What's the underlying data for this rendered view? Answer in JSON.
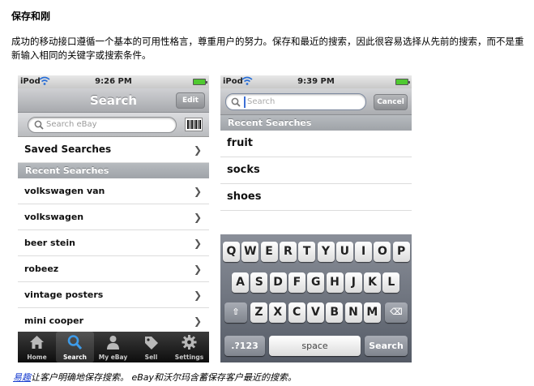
{
  "doc": {
    "title": "保存和刚",
    "paragraph": "成功的移动接口遵循一个基本的可用性格言，尊重用户的努力。保存和最近的搜索，因此很容易选择从先前的搜索，而不是重新输入相同的关键字或搜索条件。",
    "caption_link": "易趣",
    "caption_text": "让客户明确地保存搜索。 eBay和沃尔玛含蓄保存客户最近的搜索。"
  },
  "phone1": {
    "status": {
      "carrier": "iPod",
      "time": "9:26 PM"
    },
    "nav": {
      "title": "Search",
      "edit": "Edit"
    },
    "search": {
      "placeholder": "Search eBay"
    },
    "saved_searches": "Saved Searches",
    "recent_header": "Recent Searches",
    "recent": [
      "volkswagen van",
      "volkswagen",
      "beer stein",
      "robeez",
      "vintage posters",
      "mini cooper"
    ],
    "tabs": [
      "Home",
      "Search",
      "My eBay",
      "Sell",
      "Settings"
    ]
  },
  "phone2": {
    "status": {
      "carrier": "iPod",
      "time": "9:39 PM"
    },
    "search": {
      "placeholder": "Search",
      "cancel": "Cancel"
    },
    "recent_header": "Recent Searches",
    "recent": [
      "fruit",
      "socks",
      "shoes"
    ],
    "keyboard": {
      "row1": [
        "Q",
        "W",
        "E",
        "R",
        "T",
        "Y",
        "U",
        "I",
        "O",
        "P"
      ],
      "row2": [
        "A",
        "S",
        "D",
        "F",
        "G",
        "H",
        "J",
        "K",
        "L"
      ],
      "row3": [
        "Z",
        "X",
        "C",
        "V",
        "B",
        "N",
        "M"
      ],
      "numbers": ".?123",
      "space": "space",
      "search": "Search"
    }
  },
  "colors": {
    "link": "#1a3fd0",
    "battery": "#4fc930"
  }
}
